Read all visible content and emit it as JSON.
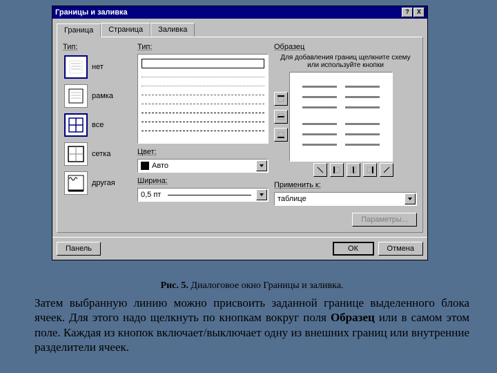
{
  "titlebar": {
    "title": "Границы и заливка",
    "help": "?",
    "close": "X"
  },
  "tabs": {
    "border": "Граница",
    "page": "Страница",
    "fill": "Заливка"
  },
  "col1": {
    "heading": "Тип:",
    "opts": {
      "none": "нет",
      "box": "рамка",
      "all": "все",
      "grid": "сетка",
      "custom": "другая"
    }
  },
  "col2": {
    "heading": "Тип:",
    "color_label": "Цвет:",
    "color_value": "Авто",
    "width_label": "Ширина:",
    "width_value": "0,5 пт"
  },
  "col3": {
    "heading": "Образец",
    "hint": "Для добавления границ щелкните схему или используйте кнопки",
    "apply_label": "Применить к:",
    "apply_value": "таблице",
    "params": "Параметры..."
  },
  "footer": {
    "toolbar": "Панель",
    "ok": "ОК",
    "cancel": "Отмена"
  },
  "caption": {
    "fig": "Рис. 5.",
    "text": " Диалоговое окно Границы и заливка."
  },
  "body": {
    "text1": "Затем выбранную линию можно присвоить заданной границе выделенного блока ячеек. Для этого надо щелкнуть по кнопкам вокруг поля ",
    "bold": "Образец",
    "text2": " или в самом этом поле. Каждая из кнопок включает/выключает одну из внешних границ или внутренние разделители ячеек."
  }
}
